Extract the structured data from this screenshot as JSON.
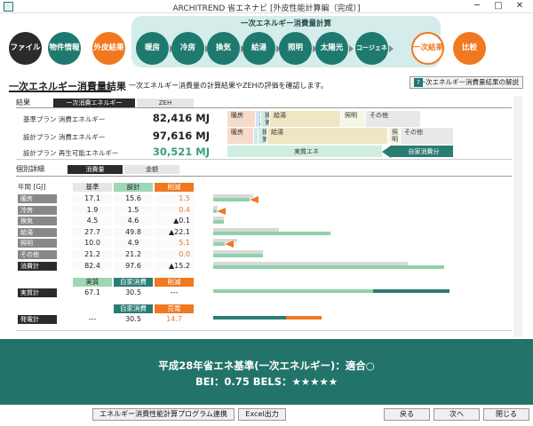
{
  "window": {
    "title": "ARCHITREND 省エネナビ [外皮性能計算編（完成）]",
    "min": "─",
    "max": "□",
    "close": "✕"
  },
  "nav": {
    "calc_group_title": "一次エネルギー消費量計算",
    "steps": [
      {
        "label": "ファイル",
        "style": "dark"
      },
      {
        "label": "物件情報",
        "style": "teal"
      },
      {
        "label": "外皮結果",
        "style": "orange"
      },
      {
        "label": "暖房",
        "style": "teal"
      },
      {
        "label": "冷房",
        "style": "teal"
      },
      {
        "label": "換気",
        "style": "teal"
      },
      {
        "label": "給湯",
        "style": "teal"
      },
      {
        "label": "照明",
        "style": "teal"
      },
      {
        "label": "太陽光",
        "style": "teal"
      },
      {
        "label": "コージェネ",
        "style": "teal"
      },
      {
        "label": "一次結果",
        "style": "selected"
      },
      {
        "label": "比較",
        "style": "orange"
      }
    ]
  },
  "page": {
    "title": "一次エネルギー消費量結果",
    "subtitle": "一次エネルギー消費量の計算結果やZEHの評価を確認します。",
    "help_button": "一次エネルギー消費量結果の解説",
    "help_icon": "?"
  },
  "result": {
    "section": "結果",
    "tabs": [
      "一次消費エネルギー",
      "ZEH"
    ],
    "rows": [
      {
        "label": "基準プラン 消費エネルギー",
        "value": "82,416 MJ"
      },
      {
        "label": "設計プラン 消費エネルギー",
        "value": "97,616 MJ"
      },
      {
        "label": "設計プラン 再生可能エネルギー",
        "value": "30,521 MJ"
      }
    ],
    "stack_base": [
      "暖房",
      "冷房",
      "換気",
      "給湯",
      "照明",
      "その他"
    ],
    "stack_design": [
      "暖房",
      "冷房",
      "換気",
      "給湯",
      "照明",
      "その他"
    ],
    "stack_renew": [
      "実質エネ",
      "自家消費分"
    ]
  },
  "detail": {
    "section": "個別詳細",
    "tabs": [
      "消費量",
      "金額"
    ],
    "unit_label": "年間 [GJ]",
    "headers": [
      "基準",
      "設計",
      "削減"
    ],
    "rows": [
      {
        "label": "暖房",
        "base": "17.1",
        "design": "15.6",
        "reduce": "1.5",
        "base_v": 17.1,
        "design_v": 15.6
      },
      {
        "label": "冷房",
        "base": "1.9",
        "design": "1.5",
        "reduce": "0.4",
        "base_v": 1.9,
        "design_v": 1.5
      },
      {
        "label": "換気",
        "base": "4.5",
        "design": "4.6",
        "reduce": "▲0.1",
        "base_v": 4.5,
        "design_v": 4.6
      },
      {
        "label": "給湯",
        "base": "27.7",
        "design": "49.8",
        "reduce": "▲22.1",
        "base_v": 27.7,
        "design_v": 49.8
      },
      {
        "label": "照明",
        "base": "10.0",
        "design": "4.9",
        "reduce": "5.1",
        "base_v": 10.0,
        "design_v": 4.9
      },
      {
        "label": "その他",
        "base": "21.2",
        "design": "21.2",
        "reduce": "0.0",
        "base_v": 21.2,
        "design_v": 21.2
      },
      {
        "label": "消費計",
        "base": "82.4",
        "design": "97.6",
        "reduce": "▲15.2",
        "base_v": 82.4,
        "design_v": 97.6
      }
    ],
    "actual": {
      "headers": [
        "実質",
        "自家消費",
        "削減"
      ],
      "label": "実質計",
      "values": [
        "67.1",
        "30.5",
        "---"
      ]
    },
    "gen": {
      "headers": [
        "自家消費",
        "売電"
      ],
      "label": "発電計",
      "values": [
        "---",
        "30.5",
        "14.7"
      ]
    }
  },
  "footer": {
    "line1": "平成28年省エネ基準(一次エネルギー)：適合○",
    "line2": "BEI：0.75  BELS：★★★★★"
  },
  "buttons": {
    "program": "エネルギー消費性能計算プログラム連携",
    "excel": "Excel出力",
    "back": "戻る",
    "next": "次へ",
    "close": "閉じる"
  },
  "colors": {
    "teal": "#1e7a6e",
    "orange": "#f07820",
    "dark": "#2b2b2b",
    "bar_green": "#8fd1aa",
    "bar_gray": "#d9d9d9"
  }
}
